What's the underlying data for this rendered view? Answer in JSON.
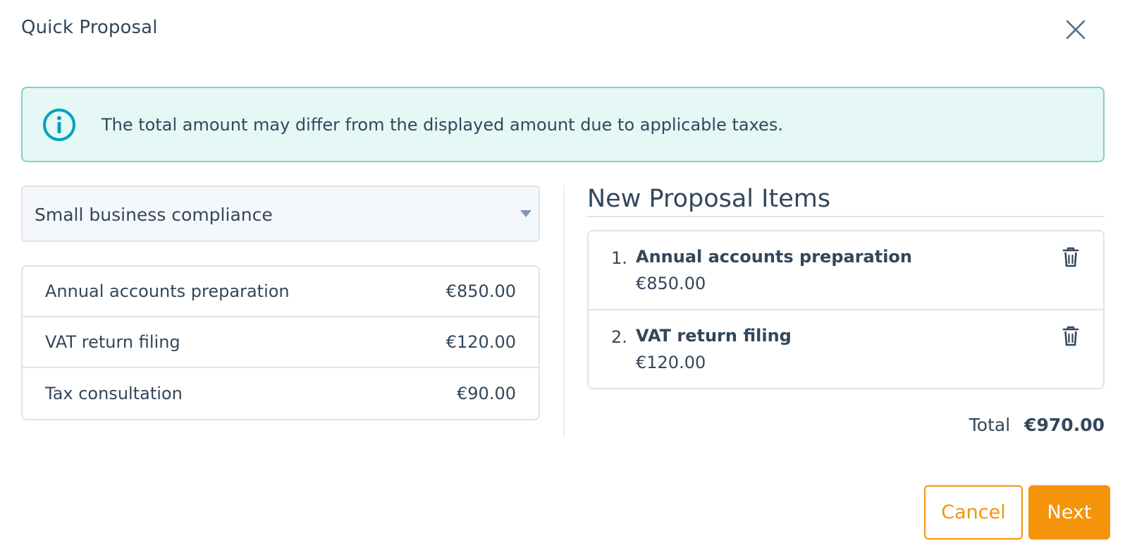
{
  "dialog": {
    "title": "Quick Proposal",
    "close_icon": "close-icon"
  },
  "alert": {
    "icon": "info-icon",
    "text": "The total amount may differ from the displayed amount due to applicable taxes."
  },
  "package_select": {
    "selected": "Small business compliance"
  },
  "catalog": [
    {
      "name": "Annual accounts preparation",
      "price": "€850.00"
    },
    {
      "name": "VAT return filing",
      "price": "€120.00"
    },
    {
      "name": "Tax consultation",
      "price": "€90.00"
    }
  ],
  "proposal": {
    "heading": "New Proposal Items",
    "items": [
      {
        "number": "1.",
        "name": "Annual accounts preparation",
        "price": "€850.00",
        "remove_icon": "trash-icon"
      },
      {
        "number": "2.",
        "name": "VAT return filing",
        "price": "€120.00",
        "remove_icon": "trash-icon"
      }
    ],
    "total_label": "Total",
    "total_value": "€970.00"
  },
  "footer": {
    "cancel_label": "Cancel",
    "next_label": "Next"
  },
  "colors": {
    "accent": "#f5930a",
    "text": "#33475b",
    "info_bg": "#e5f8f6",
    "info_border": "#7fd1c7",
    "info_icon": "#00a4bd"
  }
}
